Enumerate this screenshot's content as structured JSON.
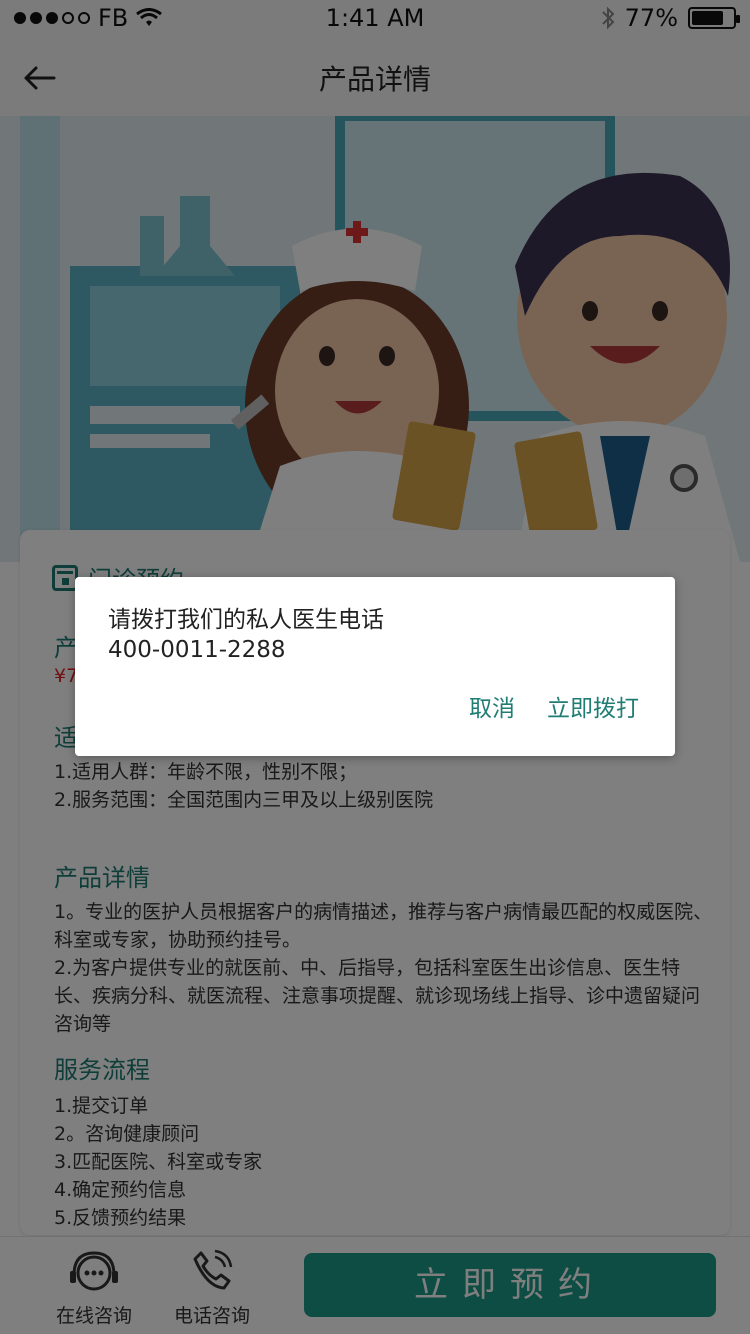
{
  "status_bar": {
    "carrier": "FB",
    "time": "1:41 AM",
    "battery": "77%",
    "battery_level": 0.77,
    "signal_filled": 3,
    "signal_total": 5
  },
  "nav": {
    "title": "产品详情",
    "back_icon": "arrow-left-icon"
  },
  "content": {
    "appointment_title": "门诊预约",
    "product_label": "产",
    "price_fragment": "¥7",
    "applicable_label": "适",
    "applicable_lines": [
      "1.适用人群：年龄不限，性别不限；",
      "2.服务范围：全国范围内三甲及以上级别医院"
    ],
    "details_title": "产品详情",
    "details_lines": [
      "1。专业的医护人员根据客户的病情描述，推荐与客户病情最匹配的权威医院、科室或专家，协助预约挂号。",
      "2.为客户提供专业的就医前、中、后指导，包括科室医生出诊信息、医生特长、疾病分科、就医流程、注意事项提醒、就诊现场线上指导、诊中遗留疑问咨询等"
    ],
    "process_title": "服务流程",
    "process_steps": [
      "1.提交订单",
      "2。咨询健康顾问",
      "3.匹配医院、科室或专家",
      "4.确定预约信息",
      "5.反馈预约结果"
    ]
  },
  "bottom_bar": {
    "online_label": "在线咨询",
    "phone_label": "电话咨询",
    "book_label": "立即预约"
  },
  "dialog": {
    "message": "请拨打我们的私人医生电话",
    "phone": "400-0011-2288",
    "cancel": "取消",
    "call": "立即拨打"
  },
  "colors": {
    "accent": "#1f7d74",
    "button": "#1a9a86",
    "price": "#e02020"
  }
}
